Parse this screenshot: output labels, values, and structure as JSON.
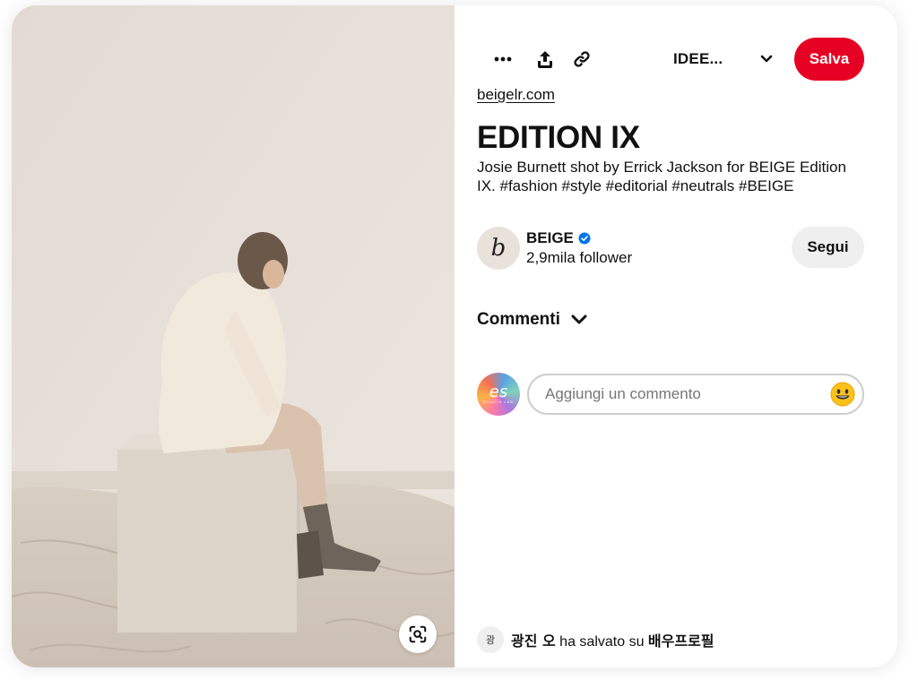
{
  "toolbar": {
    "more_icon": "ellipsis-icon",
    "share_icon": "share-upload-icon",
    "link_icon": "link-icon",
    "board_label": "IDEE...",
    "board_chevron": "chevron-down-icon",
    "save_label": "Salva"
  },
  "pin": {
    "source": "beigelr.com",
    "title": "EDITION IX",
    "description": "Josie Burnett shot by Errick Jackson for BEIGE Edition IX. #fashion #style #editorial #neutrals #BEIGE"
  },
  "creator": {
    "avatar_letter": "b",
    "name": "BEIGE",
    "verified_icon": "verified-badge-icon",
    "followers": "2,9mila follower",
    "follow_label": "Segui"
  },
  "comments": {
    "header": "Commenti",
    "placeholder": "Aggiungi un commento",
    "avatar_text": "es",
    "avatar_subtext": "STUDIO LAB",
    "emoji_icon": "smiley-emoji-icon"
  },
  "saved_by": {
    "avatar_text": "광",
    "user": "광진 오",
    "middle": " ha salvato su ",
    "board": "배우프로필"
  },
  "colors": {
    "save_button": "#e60023",
    "follow_button": "#efefef",
    "verified": "#0074e8"
  },
  "image": {
    "visual_search_icon": "visual-search-icon"
  }
}
